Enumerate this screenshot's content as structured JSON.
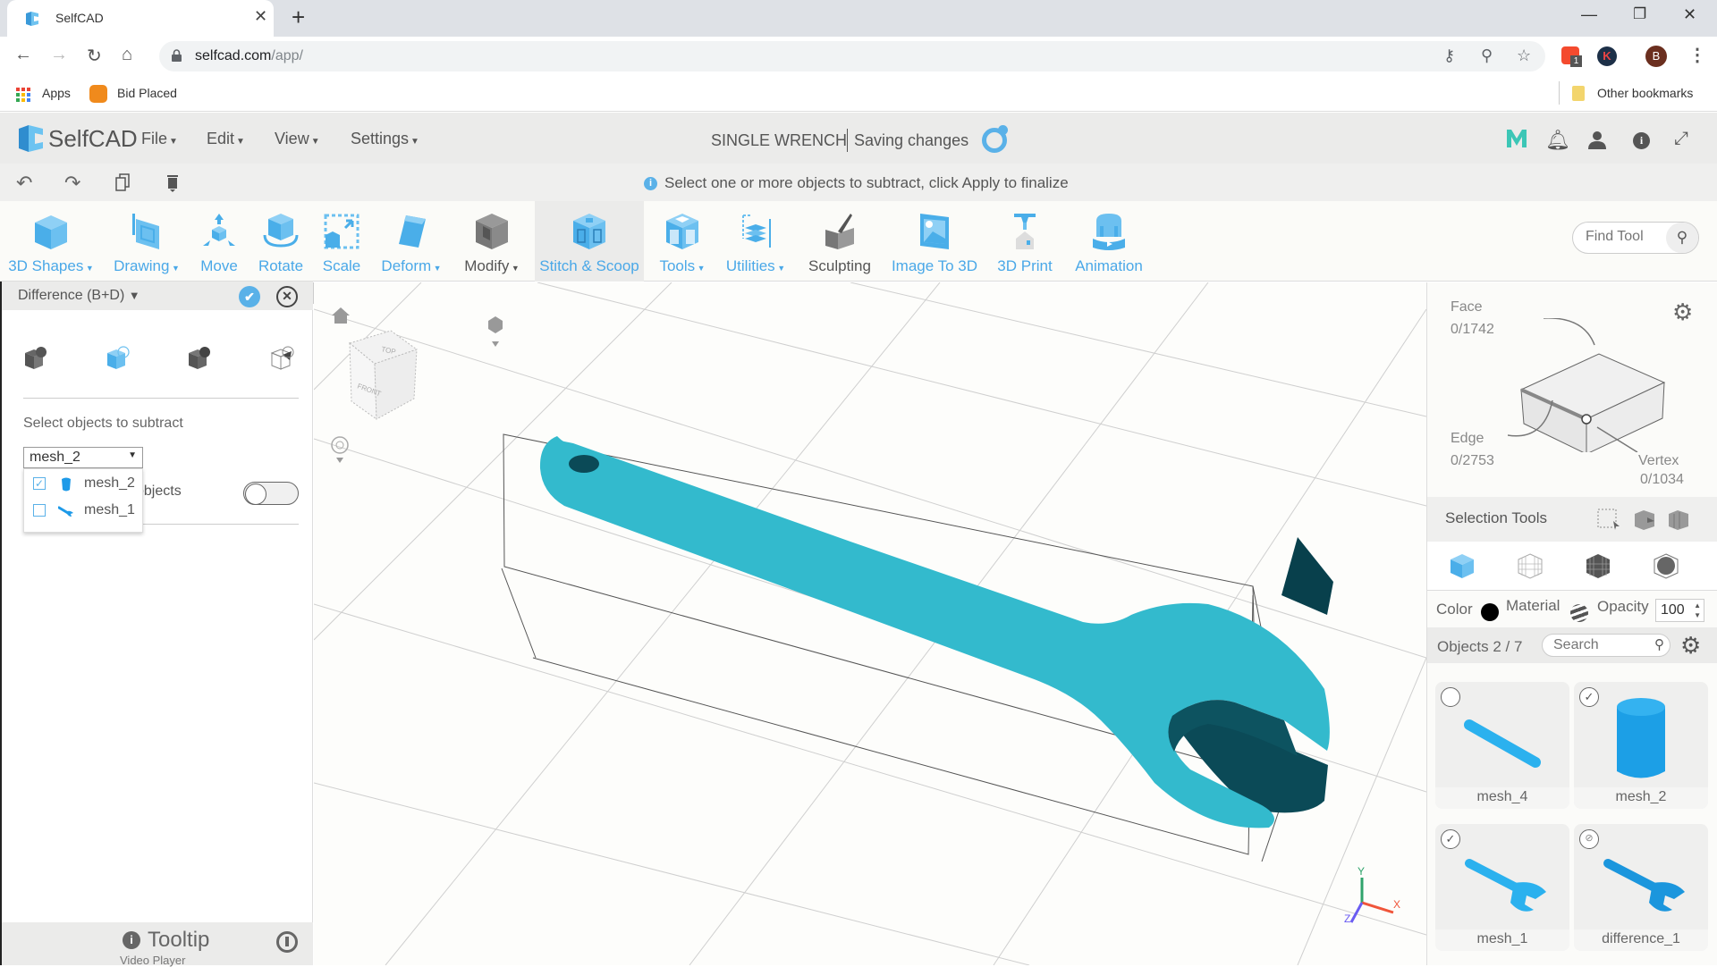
{
  "browser": {
    "tab_title": "SelfCAD",
    "url_host": "selfcad.com",
    "url_path": "/app/",
    "extension_badge": "1",
    "profile_initial": "B",
    "ext_k_initial": "K",
    "bookmarks": [
      {
        "label": "Apps",
        "icon": "apps-grid-icon"
      },
      {
        "label": "Bid Placed",
        "icon": "bid-placed-icon"
      }
    ],
    "other_bookmarks": "Other bookmarks"
  },
  "app": {
    "brand": "SelfCAD",
    "menus": [
      {
        "label": "File"
      },
      {
        "label": "Edit"
      },
      {
        "label": "View"
      },
      {
        "label": "Settings"
      }
    ],
    "doc_title": "SINGLE WRENCH",
    "save_status": "Saving changes",
    "header_icons": [
      "m-logo-icon",
      "bell-icon",
      "user-icon",
      "info-icon",
      "fullscreen-icon"
    ],
    "hint": "Select one or more objects to subtract, click Apply to finalize",
    "quick_actions": [
      "undo-icon",
      "redo-icon",
      "copy-icon",
      "delete-icon"
    ]
  },
  "ribbon": {
    "tools": [
      {
        "label": "3D Shapes",
        "dropdown": true
      },
      {
        "label": "Drawing",
        "dropdown": true
      },
      {
        "label": "Move",
        "dropdown": false
      },
      {
        "label": "Rotate",
        "dropdown": false
      },
      {
        "label": "Scale",
        "dropdown": false
      },
      {
        "label": "Deform",
        "dropdown": true
      },
      {
        "label": "Modify",
        "dropdown": true
      },
      {
        "label": "Stitch & Scoop",
        "dropdown": false,
        "active": true
      },
      {
        "label": "Tools",
        "dropdown": true
      },
      {
        "label": "Utilities",
        "dropdown": true
      },
      {
        "label": "Sculpting",
        "dropdown": false
      },
      {
        "label": "Image To 3D",
        "dropdown": false
      },
      {
        "label": "3D Print",
        "dropdown": false
      },
      {
        "label": "Animation",
        "dropdown": false
      }
    ],
    "find_tool_placeholder": "Find Tool"
  },
  "left_panel": {
    "title": "Difference (B+D)",
    "operations": [
      "union-icon",
      "difference-icon",
      "intersection-icon",
      "slice-icon"
    ],
    "select_label": "Select objects to subtract",
    "selected_value": "mesh_2",
    "options": [
      {
        "name": "mesh_2",
        "checked": true,
        "icon": "cylinder-icon"
      },
      {
        "name": "mesh_1",
        "checked": false,
        "icon": "wrench-icon"
      }
    ],
    "objects_toggle_label": "objects",
    "objects_toggle_on": false,
    "footer_title": "Tooltip",
    "footer_sub": "Video Player"
  },
  "viewport": {
    "nav_cube_top": "TOP",
    "nav_cube_front": "FRONT",
    "axis_labels": {
      "x": "X",
      "y": "Y",
      "z": "Z"
    },
    "colors": {
      "wrench_top": "#33bacd",
      "wrench_side": "#0b4a57",
      "grid": "#c8c8c8"
    }
  },
  "right_panel": {
    "face_label": "Face",
    "face_count": "0/1742",
    "edge_label": "Edge",
    "edge_count": "0/2753",
    "vertex_label": "Vertex",
    "vertex_count": "0/1034",
    "selection_tools_label": "Selection Tools",
    "color_label": "Color",
    "material_label": "Material",
    "opacity_label": "Opacity",
    "opacity_value": "100",
    "objects_label": "Objects 2 / 7",
    "search_placeholder": "Search",
    "objects": [
      {
        "name": "mesh_4",
        "state": "unselected",
        "shape": "bar"
      },
      {
        "name": "mesh_2",
        "state": "selected",
        "shape": "cylinder"
      },
      {
        "name": "mesh_1",
        "state": "selected",
        "shape": "wrench"
      },
      {
        "name": "difference_1",
        "state": "hidden",
        "shape": "wrench"
      }
    ],
    "accent": "#1da6ea"
  }
}
